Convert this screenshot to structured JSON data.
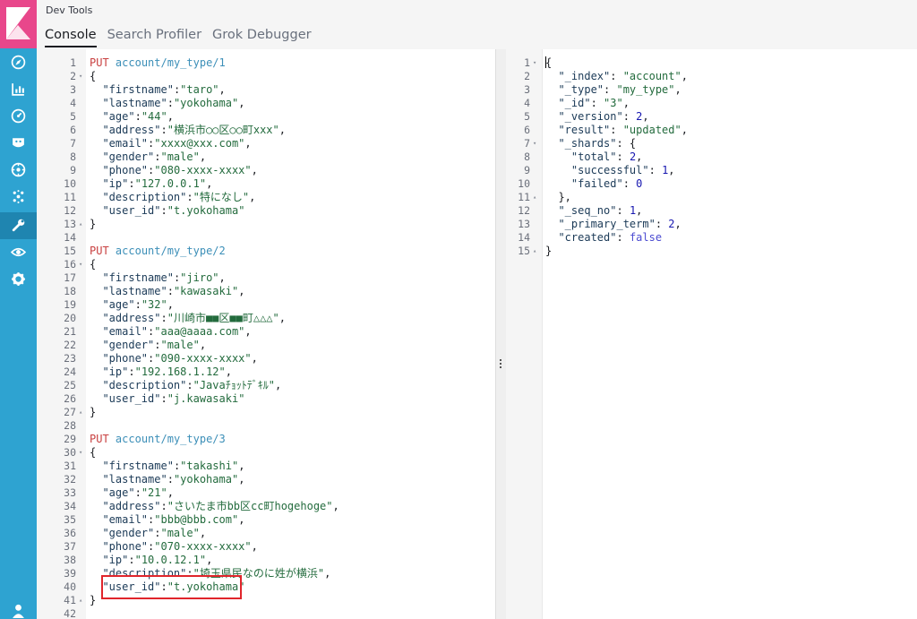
{
  "app": {
    "title": "Dev Tools"
  },
  "tabs": [
    {
      "label": "Console",
      "active": true
    },
    {
      "label": "Search Profiler",
      "active": false
    },
    {
      "label": "Grok Debugger",
      "active": false
    }
  ],
  "nav": [
    "discover-icon",
    "visualize-icon",
    "dashboard-icon",
    "canvas-icon",
    "maps-icon",
    "ml-icon",
    "devtools-icon",
    "monitoring-icon",
    "management-icon",
    "user-icon"
  ],
  "colors": {
    "nav": "#2ea3d1",
    "logo": "#e8478b",
    "method": "#c83f3f",
    "url": "#3c8fb8",
    "string": "#236b3d",
    "highlight": "#e0252b"
  },
  "request_lines": [
    {
      "n": "1",
      "fold": "",
      "parts": [
        [
          "m",
          "PUT"
        ],
        [
          "p",
          " "
        ],
        [
          "u",
          "account/my_type/1"
        ]
      ]
    },
    {
      "n": "2",
      "fold": "-",
      "parts": [
        [
          "p",
          "{"
        ]
      ]
    },
    {
      "n": "3",
      "fold": "",
      "parts": [
        [
          "p",
          "  "
        ],
        [
          "k",
          "\"firstname\""
        ],
        [
          "p",
          ":"
        ],
        [
          "s",
          "\"taro\""
        ],
        [
          "p",
          ","
        ]
      ]
    },
    {
      "n": "4",
      "fold": "",
      "parts": [
        [
          "p",
          "  "
        ],
        [
          "k",
          "\"lastname\""
        ],
        [
          "p",
          ":"
        ],
        [
          "s",
          "\"yokohama\""
        ],
        [
          "p",
          ","
        ]
      ]
    },
    {
      "n": "5",
      "fold": "",
      "parts": [
        [
          "p",
          "  "
        ],
        [
          "k",
          "\"age\""
        ],
        [
          "p",
          ":"
        ],
        [
          "s",
          "\"44\""
        ],
        [
          "p",
          ","
        ]
      ]
    },
    {
      "n": "6",
      "fold": "",
      "parts": [
        [
          "p",
          "  "
        ],
        [
          "k",
          "\"address\""
        ],
        [
          "p",
          ":"
        ],
        [
          "s",
          "\"横浜市○○区○○町xxx\""
        ],
        [
          "p",
          ","
        ]
      ]
    },
    {
      "n": "7",
      "fold": "",
      "parts": [
        [
          "p",
          "  "
        ],
        [
          "k",
          "\"email\""
        ],
        [
          "p",
          ":"
        ],
        [
          "s",
          "\"xxxx@xxx.com\""
        ],
        [
          "p",
          ","
        ]
      ]
    },
    {
      "n": "8",
      "fold": "",
      "parts": [
        [
          "p",
          "  "
        ],
        [
          "k",
          "\"gender\""
        ],
        [
          "p",
          ":"
        ],
        [
          "s",
          "\"male\""
        ],
        [
          "p",
          ","
        ]
      ]
    },
    {
      "n": "9",
      "fold": "",
      "parts": [
        [
          "p",
          "  "
        ],
        [
          "k",
          "\"phone\""
        ],
        [
          "p",
          ":"
        ],
        [
          "s",
          "\"080-xxxx-xxxx\""
        ],
        [
          "p",
          ","
        ]
      ]
    },
    {
      "n": "10",
      "fold": "",
      "parts": [
        [
          "p",
          "  "
        ],
        [
          "k",
          "\"ip\""
        ],
        [
          "p",
          ":"
        ],
        [
          "s",
          "\"127.0.0.1\""
        ],
        [
          "p",
          ","
        ]
      ]
    },
    {
      "n": "11",
      "fold": "",
      "parts": [
        [
          "p",
          "  "
        ],
        [
          "k",
          "\"description\""
        ],
        [
          "p",
          ":"
        ],
        [
          "s",
          "\"特になし\""
        ],
        [
          "p",
          ","
        ]
      ]
    },
    {
      "n": "12",
      "fold": "",
      "parts": [
        [
          "p",
          "  "
        ],
        [
          "k",
          "\"user_id\""
        ],
        [
          "p",
          ":"
        ],
        [
          "s",
          "\"t.yokohama\""
        ]
      ]
    },
    {
      "n": "13",
      "fold": "^",
      "parts": [
        [
          "p",
          "}"
        ]
      ]
    },
    {
      "n": "14",
      "fold": "",
      "parts": []
    },
    {
      "n": "15",
      "fold": "",
      "parts": [
        [
          "m",
          "PUT"
        ],
        [
          "p",
          " "
        ],
        [
          "u",
          "account/my_type/2"
        ]
      ]
    },
    {
      "n": "16",
      "fold": "-",
      "parts": [
        [
          "p",
          "{"
        ]
      ]
    },
    {
      "n": "17",
      "fold": "",
      "parts": [
        [
          "p",
          "  "
        ],
        [
          "k",
          "\"firstname\""
        ],
        [
          "p",
          ":"
        ],
        [
          "s",
          "\"jiro\""
        ],
        [
          "p",
          ","
        ]
      ]
    },
    {
      "n": "18",
      "fold": "",
      "parts": [
        [
          "p",
          "  "
        ],
        [
          "k",
          "\"lastname\""
        ],
        [
          "p",
          ":"
        ],
        [
          "s",
          "\"kawasaki\""
        ],
        [
          "p",
          ","
        ]
      ]
    },
    {
      "n": "19",
      "fold": "",
      "parts": [
        [
          "p",
          "  "
        ],
        [
          "k",
          "\"age\""
        ],
        [
          "p",
          ":"
        ],
        [
          "s",
          "\"32\""
        ],
        [
          "p",
          ","
        ]
      ]
    },
    {
      "n": "20",
      "fold": "",
      "parts": [
        [
          "p",
          "  "
        ],
        [
          "k",
          "\"address\""
        ],
        [
          "p",
          ":"
        ],
        [
          "s",
          "\"川崎市■■区■■町△△△\""
        ],
        [
          "p",
          ","
        ]
      ]
    },
    {
      "n": "21",
      "fold": "",
      "parts": [
        [
          "p",
          "  "
        ],
        [
          "k",
          "\"email\""
        ],
        [
          "p",
          ":"
        ],
        [
          "s",
          "\"aaa@aaaa.com\""
        ],
        [
          "p",
          ","
        ]
      ]
    },
    {
      "n": "22",
      "fold": "",
      "parts": [
        [
          "p",
          "  "
        ],
        [
          "k",
          "\"gender\""
        ],
        [
          "p",
          ":"
        ],
        [
          "s",
          "\"male\""
        ],
        [
          "p",
          ","
        ]
      ]
    },
    {
      "n": "23",
      "fold": "",
      "parts": [
        [
          "p",
          "  "
        ],
        [
          "k",
          "\"phone\""
        ],
        [
          "p",
          ":"
        ],
        [
          "s",
          "\"090-xxxx-xxxx\""
        ],
        [
          "p",
          ","
        ]
      ]
    },
    {
      "n": "24",
      "fold": "",
      "parts": [
        [
          "p",
          "  "
        ],
        [
          "k",
          "\"ip\""
        ],
        [
          "p",
          ":"
        ],
        [
          "s",
          "\"192.168.1.12\""
        ],
        [
          "p",
          ","
        ]
      ]
    },
    {
      "n": "25",
      "fold": "",
      "parts": [
        [
          "p",
          "  "
        ],
        [
          "k",
          "\"description\""
        ],
        [
          "p",
          ":"
        ],
        [
          "s",
          "\"Javaﾁｮｯﾄﾃﾞｷﾙ\""
        ],
        [
          "p",
          ","
        ]
      ]
    },
    {
      "n": "26",
      "fold": "",
      "parts": [
        [
          "p",
          "  "
        ],
        [
          "k",
          "\"user_id\""
        ],
        [
          "p",
          ":"
        ],
        [
          "s",
          "\"j.kawasaki\""
        ]
      ]
    },
    {
      "n": "27",
      "fold": "^",
      "parts": [
        [
          "p",
          "}"
        ]
      ]
    },
    {
      "n": "28",
      "fold": "",
      "parts": []
    },
    {
      "n": "29",
      "fold": "",
      "parts": [
        [
          "m",
          "PUT"
        ],
        [
          "p",
          " "
        ],
        [
          "u",
          "account/my_type/3"
        ]
      ]
    },
    {
      "n": "30",
      "fold": "-",
      "parts": [
        [
          "p",
          "{"
        ]
      ]
    },
    {
      "n": "31",
      "fold": "",
      "parts": [
        [
          "p",
          "  "
        ],
        [
          "k",
          "\"firstname\""
        ],
        [
          "p",
          ":"
        ],
        [
          "s",
          "\"takashi\""
        ],
        [
          "p",
          ","
        ]
      ]
    },
    {
      "n": "32",
      "fold": "",
      "parts": [
        [
          "p",
          "  "
        ],
        [
          "k",
          "\"lastname\""
        ],
        [
          "p",
          ":"
        ],
        [
          "s",
          "\"yokohama\""
        ],
        [
          "p",
          ","
        ]
      ]
    },
    {
      "n": "33",
      "fold": "",
      "parts": [
        [
          "p",
          "  "
        ],
        [
          "k",
          "\"age\""
        ],
        [
          "p",
          ":"
        ],
        [
          "s",
          "\"21\""
        ],
        [
          "p",
          ","
        ]
      ]
    },
    {
      "n": "34",
      "fold": "",
      "parts": [
        [
          "p",
          "  "
        ],
        [
          "k",
          "\"address\""
        ],
        [
          "p",
          ":"
        ],
        [
          "s",
          "\"さいたま市bb区cc町hogehoge\""
        ],
        [
          "p",
          ","
        ]
      ]
    },
    {
      "n": "35",
      "fold": "",
      "parts": [
        [
          "p",
          "  "
        ],
        [
          "k",
          "\"email\""
        ],
        [
          "p",
          ":"
        ],
        [
          "s",
          "\"bbb@bbb.com\""
        ],
        [
          "p",
          ","
        ]
      ]
    },
    {
      "n": "36",
      "fold": "",
      "parts": [
        [
          "p",
          "  "
        ],
        [
          "k",
          "\"gender\""
        ],
        [
          "p",
          ":"
        ],
        [
          "s",
          "\"male\""
        ],
        [
          "p",
          ","
        ]
      ]
    },
    {
      "n": "37",
      "fold": "",
      "parts": [
        [
          "p",
          "  "
        ],
        [
          "k",
          "\"phone\""
        ],
        [
          "p",
          ":"
        ],
        [
          "s",
          "\"070-xxxx-xxxx\""
        ],
        [
          "p",
          ","
        ]
      ]
    },
    {
      "n": "38",
      "fold": "",
      "parts": [
        [
          "p",
          "  "
        ],
        [
          "k",
          "\"ip\""
        ],
        [
          "p",
          ":"
        ],
        [
          "s",
          "\"10.0.12.1\""
        ],
        [
          "p",
          ","
        ]
      ]
    },
    {
      "n": "39",
      "fold": "",
      "parts": [
        [
          "p",
          "  "
        ],
        [
          "k",
          "\"description\""
        ],
        [
          "p",
          ":"
        ],
        [
          "s",
          "\"埼玉県民なのに姓が横浜\""
        ],
        [
          "p",
          ","
        ]
      ]
    },
    {
      "n": "40",
      "fold": "",
      "parts": [
        [
          "p",
          "  "
        ],
        [
          "k",
          "\"user_id\""
        ],
        [
          "p",
          ":"
        ],
        [
          "s",
          "\"t.yokohama\""
        ]
      ]
    },
    {
      "n": "41",
      "fold": "^",
      "parts": [
        [
          "p",
          "}"
        ]
      ]
    },
    {
      "n": "42",
      "fold": "",
      "parts": []
    }
  ],
  "response_lines": [
    {
      "n": "1",
      "fold": "-",
      "parts": [
        [
          "p",
          "{"
        ]
      ]
    },
    {
      "n": "2",
      "fold": "",
      "parts": [
        [
          "p",
          "  "
        ],
        [
          "k",
          "\"_index\""
        ],
        [
          "p",
          ": "
        ],
        [
          "s",
          "\"account\""
        ],
        [
          "p",
          ","
        ]
      ]
    },
    {
      "n": "3",
      "fold": "",
      "parts": [
        [
          "p",
          "  "
        ],
        [
          "k",
          "\"_type\""
        ],
        [
          "p",
          ": "
        ],
        [
          "s",
          "\"my_type\""
        ],
        [
          "p",
          ","
        ]
      ]
    },
    {
      "n": "4",
      "fold": "",
      "parts": [
        [
          "p",
          "  "
        ],
        [
          "k",
          "\"_id\""
        ],
        [
          "p",
          ": "
        ],
        [
          "s",
          "\"3\""
        ],
        [
          "p",
          ","
        ]
      ]
    },
    {
      "n": "5",
      "fold": "",
      "parts": [
        [
          "p",
          "  "
        ],
        [
          "k",
          "\"_version\""
        ],
        [
          "p",
          ": "
        ],
        [
          "n",
          "2"
        ],
        [
          "p",
          ","
        ]
      ]
    },
    {
      "n": "6",
      "fold": "",
      "parts": [
        [
          "p",
          "  "
        ],
        [
          "k",
          "\"result\""
        ],
        [
          "p",
          ": "
        ],
        [
          "s",
          "\"updated\""
        ],
        [
          "p",
          ","
        ]
      ]
    },
    {
      "n": "7",
      "fold": "-",
      "parts": [
        [
          "p",
          "  "
        ],
        [
          "k",
          "\"_shards\""
        ],
        [
          "p",
          ": {"
        ]
      ]
    },
    {
      "n": "8",
      "fold": "",
      "parts": [
        [
          "p",
          "    "
        ],
        [
          "k",
          "\"total\""
        ],
        [
          "p",
          ": "
        ],
        [
          "n",
          "2"
        ],
        [
          "p",
          ","
        ]
      ]
    },
    {
      "n": "9",
      "fold": "",
      "parts": [
        [
          "p",
          "    "
        ],
        [
          "k",
          "\"successful\""
        ],
        [
          "p",
          ": "
        ],
        [
          "n",
          "1"
        ],
        [
          "p",
          ","
        ]
      ]
    },
    {
      "n": "10",
      "fold": "",
      "parts": [
        [
          "p",
          "    "
        ],
        [
          "k",
          "\"failed\""
        ],
        [
          "p",
          ": "
        ],
        [
          "n",
          "0"
        ]
      ]
    },
    {
      "n": "11",
      "fold": "^",
      "parts": [
        [
          "p",
          "  },"
        ]
      ]
    },
    {
      "n": "12",
      "fold": "",
      "parts": [
        [
          "p",
          "  "
        ],
        [
          "k",
          "\"_seq_no\""
        ],
        [
          "p",
          ": "
        ],
        [
          "n",
          "1"
        ],
        [
          "p",
          ","
        ]
      ]
    },
    {
      "n": "13",
      "fold": "",
      "parts": [
        [
          "p",
          "  "
        ],
        [
          "k",
          "\"_primary_term\""
        ],
        [
          "p",
          ": "
        ],
        [
          "n",
          "2"
        ],
        [
          "p",
          ","
        ]
      ]
    },
    {
      "n": "14",
      "fold": "",
      "parts": [
        [
          "p",
          "  "
        ],
        [
          "k",
          "\"created\""
        ],
        [
          "p",
          ": "
        ],
        [
          "b",
          "false"
        ]
      ]
    },
    {
      "n": "15",
      "fold": "^",
      "parts": [
        [
          "p",
          "}"
        ]
      ]
    }
  ]
}
